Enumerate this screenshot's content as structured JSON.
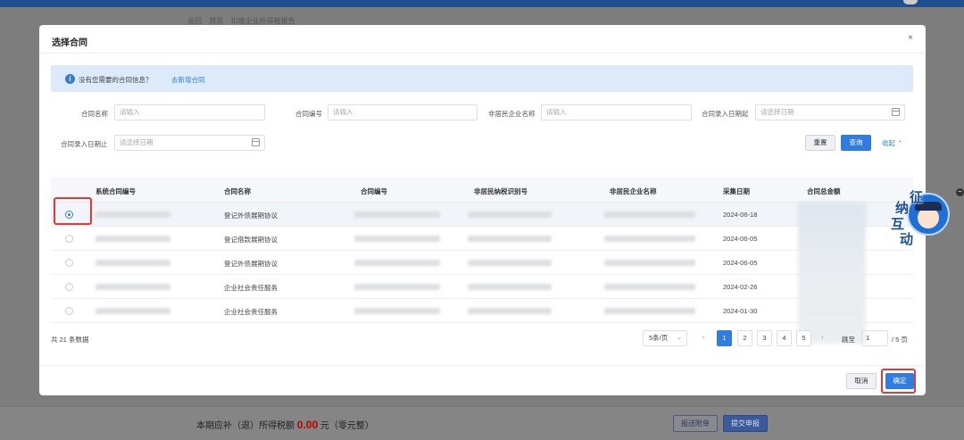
{
  "background": {
    "breadcrumb": [
      "返回",
      "首页",
      "扣缴企业所得税报告"
    ],
    "footer_text_prefix": "本期应补（退）所得税额",
    "footer_amount": "0.00",
    "footer_text_suffix": "元（零元整）",
    "footer_buttons": [
      "报送附单",
      "提交申报"
    ]
  },
  "modal": {
    "title": "选择合同",
    "close": "×",
    "info": {
      "icon": "info-icon",
      "text": "没有您需要的合同信息？",
      "link": "去新增合同"
    },
    "filters": [
      {
        "label": "合同名称",
        "placeholder": "请输入"
      },
      {
        "label": "合同编号",
        "placeholder": "请输入"
      },
      {
        "label": "非居民企业名称",
        "placeholder": "请输入"
      },
      {
        "label": "合同录入日期起",
        "placeholder": "请选择日期"
      },
      {
        "label": "合同录入日期止",
        "placeholder": "请选择日期"
      }
    ],
    "buttons": {
      "reset": "重置",
      "query": "查询",
      "collapse": "收起"
    },
    "table": {
      "columns": [
        "系统合同编号",
        "合同名称",
        "合同编号",
        "非居民纳税识别号",
        "非居民企业名称",
        "采集日期",
        "合同总金额"
      ],
      "rows": [
        {
          "selected": true,
          "name": "登记外债展期协议",
          "date": "2024-06-18"
        },
        {
          "selected": false,
          "name": "登记借款展期协议",
          "date": "2024-06-05"
        },
        {
          "selected": false,
          "name": "登记外债展期协议",
          "date": "2024-06-05"
        },
        {
          "selected": false,
          "name": "企业社会责任服务",
          "date": "2024-02-26"
        },
        {
          "selected": false,
          "name": "企业社会责任服务",
          "date": "2024-01-30"
        }
      ]
    },
    "pagination": {
      "total": "共 21 条数据",
      "page_size": "5条/页",
      "pages": [
        "1",
        "2",
        "3",
        "4",
        "5"
      ],
      "current": "1",
      "jump_label": "跳至",
      "jump_value": "1",
      "total_pages": "/ 5 页"
    },
    "footer": {
      "cancel": "取消",
      "ok": "确定"
    }
  },
  "widget": {
    "chars": [
      "征",
      "纳",
      "互",
      "动"
    ],
    "minimize": "−"
  },
  "colors": {
    "accent": "#2f7de1",
    "highlight": "#e53935",
    "info_bg": "#dceaf9"
  }
}
